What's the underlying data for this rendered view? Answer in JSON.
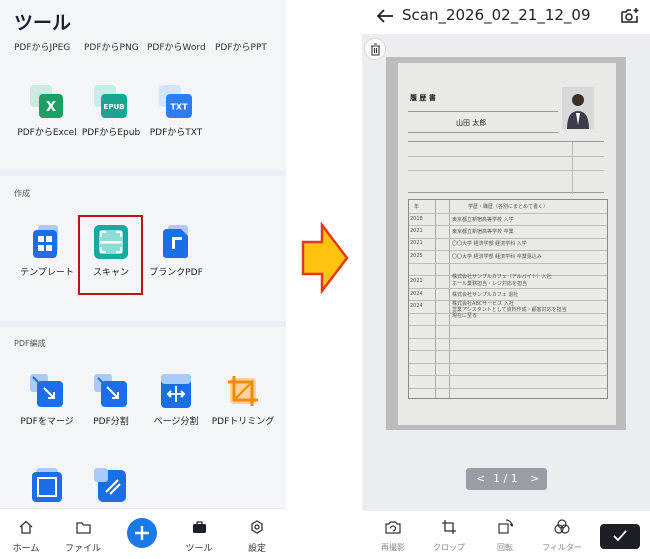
{
  "left": {
    "title": "ツール",
    "top_row": [
      "PDFからJPEG",
      "PDFからPNG",
      "PDFからWord",
      "PDFからPPT"
    ],
    "convert_items": [
      {
        "label": "PDFからExcel",
        "icon": "excel-icon",
        "badge": "X",
        "color": "#1e9e62"
      },
      {
        "label": "PDFからEpub",
        "icon": "epub-icon",
        "badge": "EPUB",
        "color": "#1aa592"
      },
      {
        "label": "PDFからTXT",
        "icon": "txt-icon",
        "badge": "TXT",
        "color": "#2e7cf0"
      }
    ],
    "section_create": "作成",
    "create_items": [
      {
        "label": "テンプレート",
        "icon": "template-icon"
      },
      {
        "label": "スキャン",
        "icon": "scan-icon"
      },
      {
        "label": "ブランクPDF",
        "icon": "blank-pdf-icon"
      }
    ],
    "section_edit": "PDF編成",
    "edit_items": [
      {
        "label": "PDFをマージ",
        "icon": "merge-icon"
      },
      {
        "label": "PDF分割",
        "icon": "split-icon"
      },
      {
        "label": "ページ分割",
        "icon": "page-split-icon"
      },
      {
        "label": "PDFトリミング",
        "icon": "crop-icon"
      }
    ],
    "nav": [
      {
        "label": "ホーム",
        "icon": "home-icon"
      },
      {
        "label": "ファイル",
        "icon": "folder-icon"
      },
      {
        "label": "",
        "icon": "plus-icon"
      },
      {
        "label": "ツール",
        "icon": "toolbox-icon"
      },
      {
        "label": "設定",
        "icon": "settings-icon"
      }
    ],
    "accent": "#1a78e8",
    "highlight_color": "#c0121c"
  },
  "right": {
    "title": "Scan_2026_02_21_12_09",
    "pager": {
      "prev": "<",
      "text": "1 / 1",
      "next": ">"
    },
    "tools": [
      {
        "label": "再撮影",
        "icon": "retake-camera-icon"
      },
      {
        "label": "クロップ",
        "icon": "crop-icon"
      },
      {
        "label": "回転",
        "icon": "rotate-icon"
      },
      {
        "label": "フィルター",
        "icon": "filter-icon"
      }
    ],
    "document": {
      "heading": "履 歴 書",
      "name": "山田 太郎",
      "header_row": "学歴・職歴（各別にまとめて書く）",
      "years": [
        "年",
        "2018",
        "2021",
        "2021",
        "2025",
        "2021",
        "2024",
        "2024"
      ],
      "entries": [
        "東京都立新宿高等学校 入学",
        "東京都立新宿高等学校 卒業",
        "〇〇大学 経済学部 経済学科 入学",
        "〇〇大学 経済学部 経済学科 卒業見込み",
        "株式会社サンプルカフェ（アルバイト）入社",
        "ホール業務担当・レジ対応を担当",
        "株式会社サンプルカフェ 退社",
        "株式会社ABCサービス 入社",
        "営業アシスタントとして資料作成・顧客対応を担当",
        "現在に至る"
      ]
    }
  }
}
